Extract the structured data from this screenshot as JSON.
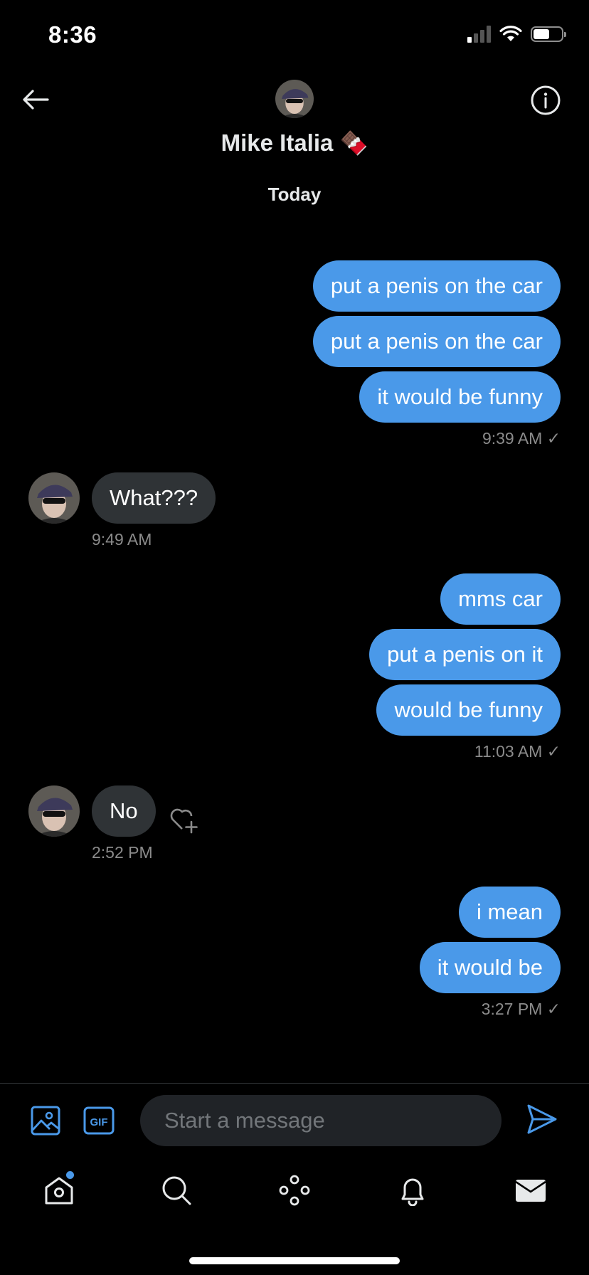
{
  "status": {
    "time": "8:36"
  },
  "header": {
    "contact_name": "Mike Italia",
    "name_emoji": "🍫",
    "day_separator": "Today"
  },
  "messages": [
    {
      "from": "me",
      "text": "put a penis on the car"
    },
    {
      "from": "me",
      "text": "put a penis on the car"
    },
    {
      "from": "me",
      "text": "it would be funny",
      "time": "9:39 AM ✓"
    },
    {
      "from": "them",
      "text": "What???",
      "time": "9:49 AM"
    },
    {
      "from": "me",
      "text": "mms car"
    },
    {
      "from": "me",
      "text": "put a penis on it"
    },
    {
      "from": "me",
      "text": "would be funny",
      "time": "11:03 AM ✓"
    },
    {
      "from": "them",
      "text": "No",
      "time": "2:52 PM"
    },
    {
      "from": "me",
      "text": "i mean"
    },
    {
      "from": "me",
      "text": "it would be",
      "time": "3:27 PM ✓"
    }
  ],
  "composer": {
    "placeholder": "Start a message",
    "gif_label": "GIF"
  },
  "nav": {
    "items": [
      "home-icon",
      "search-icon",
      "spaces-icon",
      "bell-icon",
      "mail-icon"
    ],
    "home_has_notification": true
  },
  "colors": {
    "accent": "#4a99e9",
    "incoming_bubble": "#2f3336",
    "background": "#000000",
    "muted_text": "#8b8b8b"
  }
}
